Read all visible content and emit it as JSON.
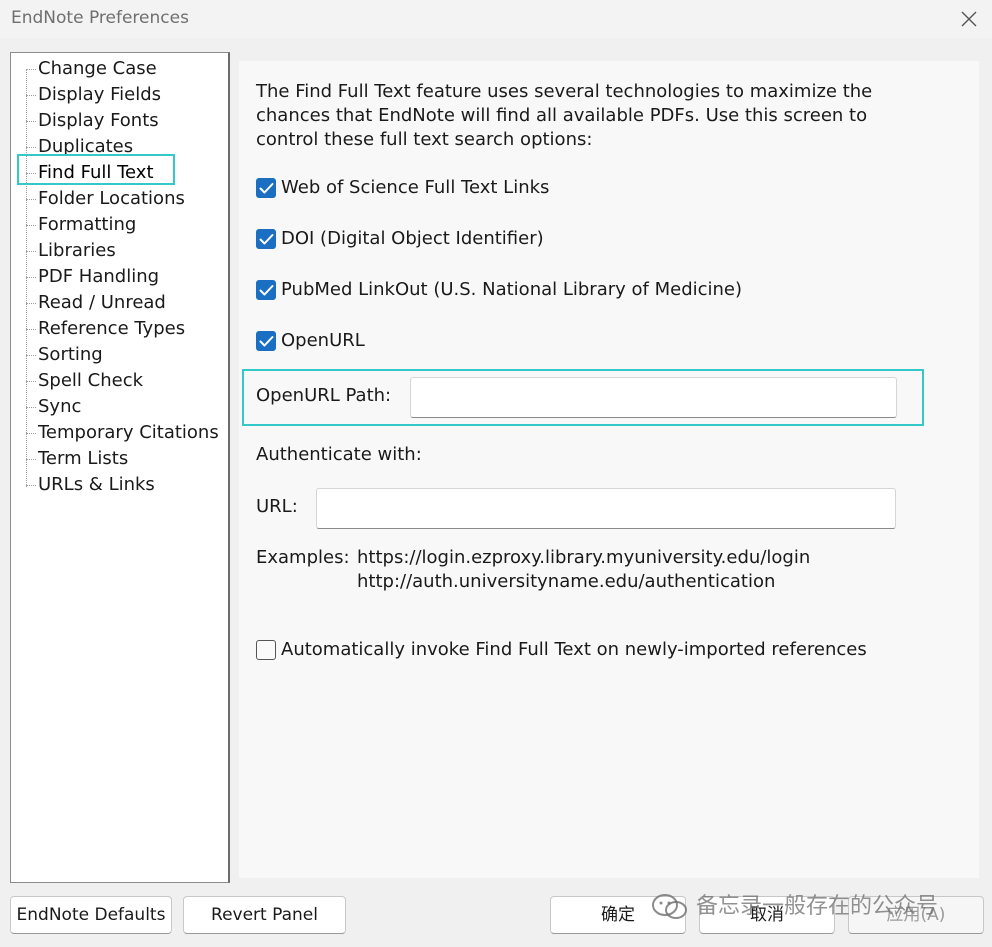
{
  "window": {
    "title": "EndNote Preferences",
    "close_icon": "close-icon"
  },
  "sidebar": {
    "items": [
      {
        "label": "Change Case"
      },
      {
        "label": "Display Fields"
      },
      {
        "label": "Display Fonts"
      },
      {
        "label": "Duplicates"
      },
      {
        "label": "Find Full Text",
        "selected": true
      },
      {
        "label": "Folder Locations"
      },
      {
        "label": "Formatting"
      },
      {
        "label": "Libraries"
      },
      {
        "label": "PDF Handling"
      },
      {
        "label": "Read / Unread"
      },
      {
        "label": "Reference Types"
      },
      {
        "label": "Sorting"
      },
      {
        "label": "Spell Check"
      },
      {
        "label": "Sync"
      },
      {
        "label": "Temporary Citations"
      },
      {
        "label": "Term Lists"
      },
      {
        "label": "URLs & Links"
      }
    ]
  },
  "main": {
    "intro_line1": "The Find Full Text feature uses several technologies to maximize the",
    "intro_line2": "chances that EndNote will find all available PDFs. Use this screen to",
    "intro_line3": "control these full text search options:",
    "options": [
      {
        "label": "Web of Science Full Text Links",
        "checked": true
      },
      {
        "label": "DOI (Digital Object Identifier)",
        "checked": true
      },
      {
        "label": "PubMed LinkOut (U.S. National Library of Medicine)",
        "checked": true
      },
      {
        "label": "OpenURL",
        "checked": true
      }
    ],
    "openurl_path_label": "OpenURL Path:",
    "openurl_path_value": "",
    "authenticate_label": "Authenticate with:",
    "url_label": "URL:",
    "url_value": "",
    "examples_label": "Examples:",
    "example_1": "https://login.ezproxy.library.myuniversity.edu/login",
    "example_2": "http://auth.universityname.edu/authentication",
    "auto_invoke_label": "Automatically invoke Find Full Text on newly-imported references",
    "auto_invoke_checked": false
  },
  "footer": {
    "defaults_label": "EndNote Defaults",
    "revert_label": "Revert Panel",
    "ok_label": "确定",
    "cancel_label": "取消",
    "apply_label": "应用(A)"
  },
  "watermark": {
    "text": "备忘录一般存在的公众号",
    "icon": "wechat-icon"
  },
  "colors": {
    "highlight": "#35c8c8",
    "checkbox_checked": "#1a6fc2"
  }
}
